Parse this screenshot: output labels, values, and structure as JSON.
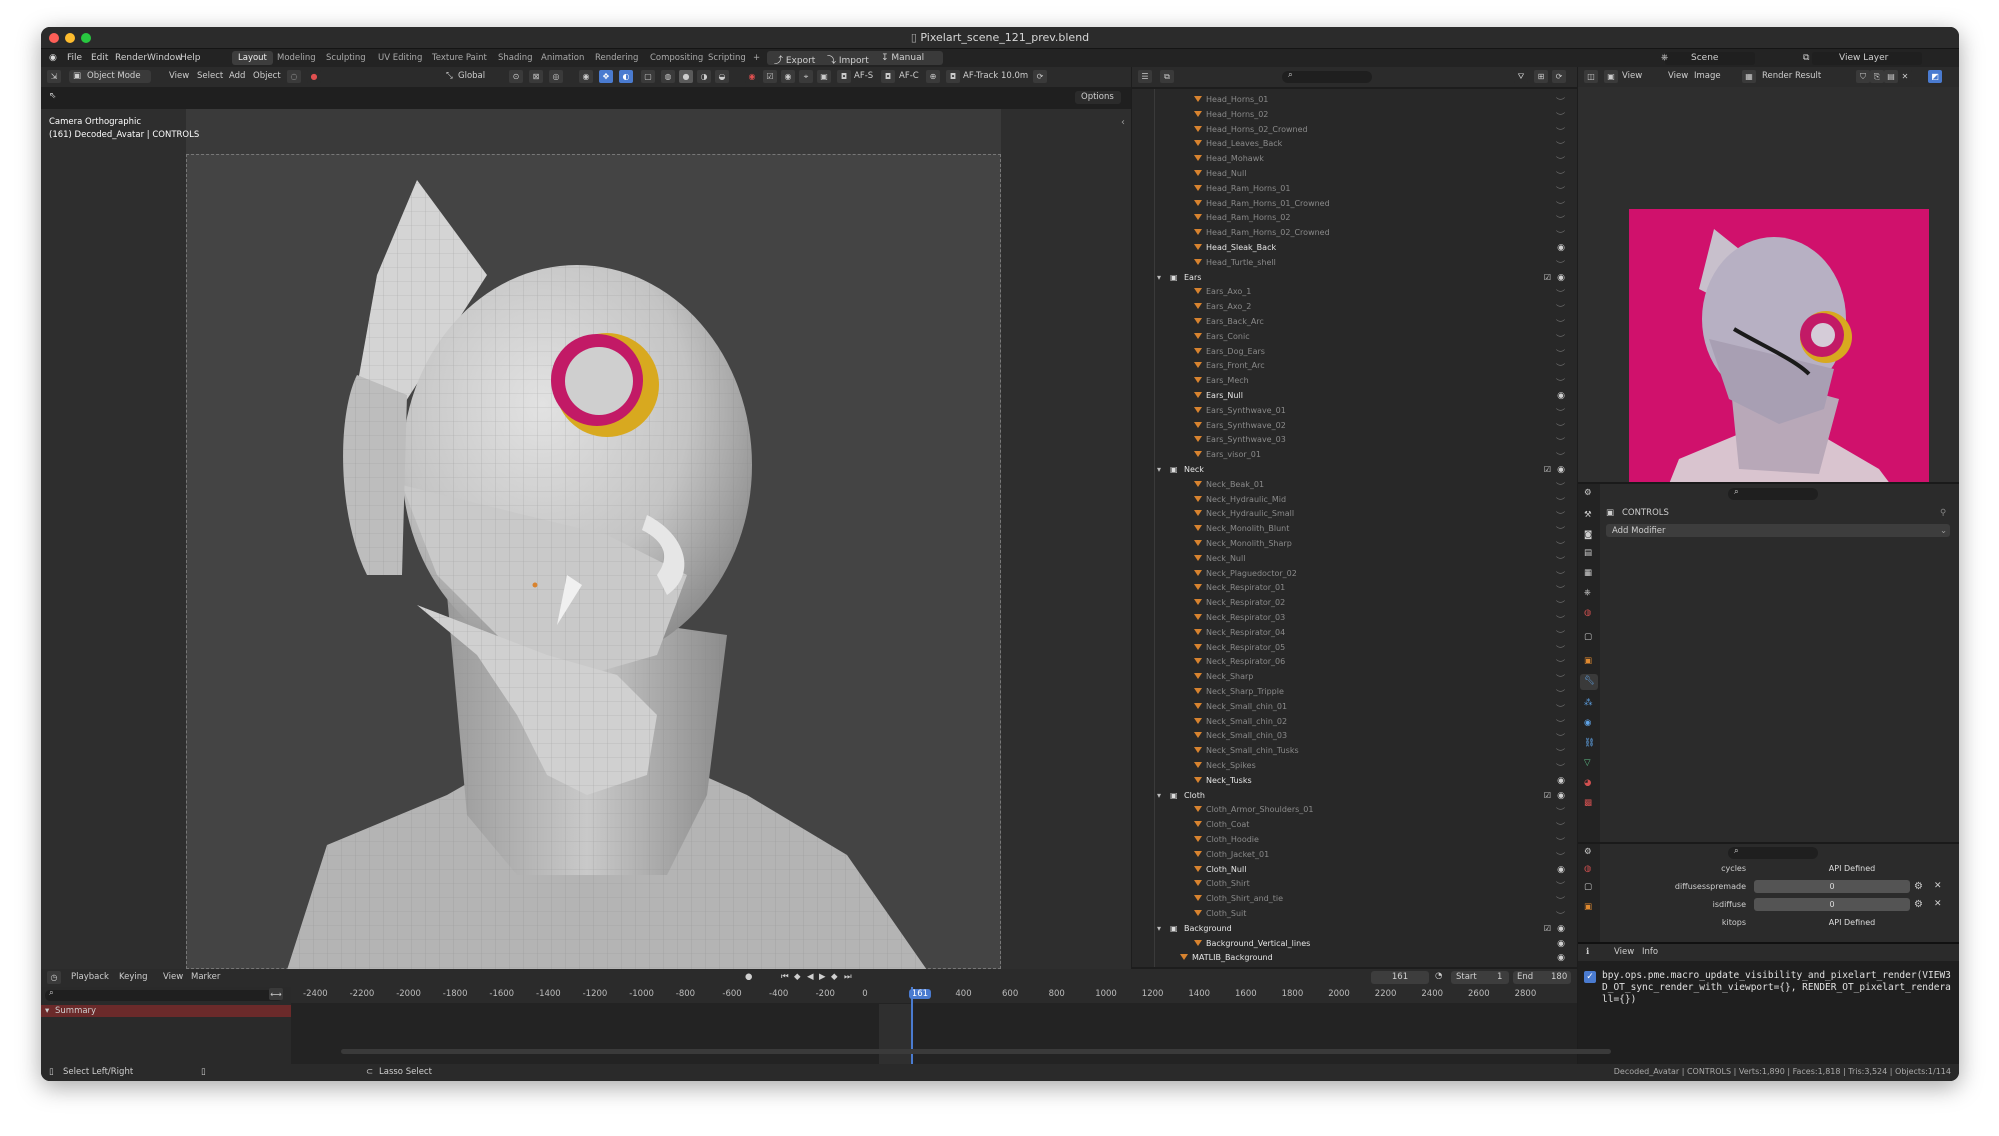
{
  "window": {
    "title": "Pixelart_scene_121_prev.blend"
  },
  "menu": [
    "File",
    "Edit",
    "Render",
    "Window",
    "Help"
  ],
  "workspaces": [
    "Layout",
    "Modeling",
    "Sculpting",
    "UV Editing",
    "Texture Paint",
    "Shading",
    "Animation",
    "Rendering",
    "Compositing",
    "Scripting"
  ],
  "workspace_active": "Layout",
  "topbar": {
    "add_tab": "+",
    "export": "Export",
    "import": "Import",
    "manual": "Manual",
    "scene": "Scene",
    "view_layer": "View Layer"
  },
  "viewport_header": {
    "mode": "Object Mode",
    "view": "View",
    "select": "Select",
    "add": "Add",
    "object": "Object",
    "orientation": "Global",
    "af_s": "AF-S",
    "af_c": "AF-C",
    "af_track": "AF-Track",
    "focus": "10.0m",
    "options": "Options"
  },
  "viewport": {
    "camera_label": "Camera Orthographic",
    "object_label": "(161) Decoded_Avatar | CONTROLS"
  },
  "outliner": {
    "rows": [
      {
        "label": "Head_Horns_01",
        "kind": "item",
        "bright": false
      },
      {
        "label": "Head_Horns_02",
        "kind": "item",
        "bright": false
      },
      {
        "label": "Head_Horns_02_Crowned",
        "kind": "item",
        "bright": false
      },
      {
        "label": "Head_Leaves_Back",
        "kind": "item",
        "bright": false
      },
      {
        "label": "Head_Mohawk",
        "kind": "item",
        "bright": false
      },
      {
        "label": "Head_Null",
        "kind": "item",
        "bright": false
      },
      {
        "label": "Head_Ram_Horns_01",
        "kind": "item",
        "bright": false
      },
      {
        "label": "Head_Ram_Horns_01_Crowned",
        "kind": "item",
        "bright": false
      },
      {
        "label": "Head_Ram_Horns_02",
        "kind": "item",
        "bright": false
      },
      {
        "label": "Head_Ram_Horns_02_Crowned",
        "kind": "item",
        "bright": false
      },
      {
        "label": "Head_Sleak_Back",
        "kind": "item",
        "bright": true
      },
      {
        "label": "Head_Turtle_shell",
        "kind": "item",
        "bright": false
      },
      {
        "label": "Ears",
        "kind": "collection",
        "bright": true
      },
      {
        "label": "Ears_Axo_1",
        "kind": "item",
        "bright": false
      },
      {
        "label": "Ears_Axo_2",
        "kind": "item",
        "bright": false
      },
      {
        "label": "Ears_Back_Arc",
        "kind": "item",
        "bright": false
      },
      {
        "label": "Ears_Conic",
        "kind": "item",
        "bright": false
      },
      {
        "label": "Ears_Dog_Ears",
        "kind": "item",
        "bright": false
      },
      {
        "label": "Ears_Front_Arc",
        "kind": "item",
        "bright": false
      },
      {
        "label": "Ears_Mech",
        "kind": "item",
        "bright": false
      },
      {
        "label": "Ears_Null",
        "kind": "item",
        "bright": true
      },
      {
        "label": "Ears_Synthwave_01",
        "kind": "item",
        "bright": false
      },
      {
        "label": "Ears_Synthwave_02",
        "kind": "item",
        "bright": false
      },
      {
        "label": "Ears_Synthwave_03",
        "kind": "item",
        "bright": false
      },
      {
        "label": "Ears_visor_01",
        "kind": "item",
        "bright": false
      },
      {
        "label": "Neck",
        "kind": "collection",
        "bright": true
      },
      {
        "label": "Neck_Beak_01",
        "kind": "item",
        "bright": false
      },
      {
        "label": "Neck_Hydraulic_Mid",
        "kind": "item",
        "bright": false
      },
      {
        "label": "Neck_Hydraulic_Small",
        "kind": "item",
        "bright": false
      },
      {
        "label": "Neck_Monolith_Blunt",
        "kind": "item",
        "bright": false
      },
      {
        "label": "Neck_Monolith_Sharp",
        "kind": "item",
        "bright": false
      },
      {
        "label": "Neck_Null",
        "kind": "item",
        "bright": false
      },
      {
        "label": "Neck_Plaguedoctor_02",
        "kind": "item",
        "bright": false
      },
      {
        "label": "Neck_Respirator_01",
        "kind": "item",
        "bright": false
      },
      {
        "label": "Neck_Respirator_02",
        "kind": "item",
        "bright": false
      },
      {
        "label": "Neck_Respirator_03",
        "kind": "item",
        "bright": false
      },
      {
        "label": "Neck_Respirator_04",
        "kind": "item",
        "bright": false
      },
      {
        "label": "Neck_Respirator_05",
        "kind": "item",
        "bright": false
      },
      {
        "label": "Neck_Respirator_06",
        "kind": "item",
        "bright": false
      },
      {
        "label": "Neck_Sharp",
        "kind": "item",
        "bright": false
      },
      {
        "label": "Neck_Sharp_Tripple",
        "kind": "item",
        "bright": false
      },
      {
        "label": "Neck_Small_chin_01",
        "kind": "item",
        "bright": false
      },
      {
        "label": "Neck_Small_chin_02",
        "kind": "item",
        "bright": false
      },
      {
        "label": "Neck_Small_chin_03",
        "kind": "item",
        "bright": false
      },
      {
        "label": "Neck_Small_chin_Tusks",
        "kind": "item",
        "bright": false
      },
      {
        "label": "Neck_Spikes",
        "kind": "item",
        "bright": false
      },
      {
        "label": "Neck_Tusks",
        "kind": "item",
        "bright": true
      },
      {
        "label": "Cloth",
        "kind": "collection",
        "bright": true
      },
      {
        "label": "Cloth_Armor_Shoulders_01",
        "kind": "item",
        "bright": false
      },
      {
        "label": "Cloth_Coat",
        "kind": "item",
        "bright": false
      },
      {
        "label": "Cloth_Hoodie",
        "kind": "item",
        "bright": false
      },
      {
        "label": "Cloth_Jacket_01",
        "kind": "item",
        "bright": false
      },
      {
        "label": "Cloth_Null",
        "kind": "item",
        "bright": true
      },
      {
        "label": "Cloth_Shirt",
        "kind": "item",
        "bright": false
      },
      {
        "label": "Cloth_Shirt_and_tie",
        "kind": "item",
        "bright": false
      },
      {
        "label": "Cloth_Suit",
        "kind": "item",
        "bright": false
      },
      {
        "label": "Background",
        "kind": "collection",
        "bright": true
      },
      {
        "label": "Background_Vertical_lines",
        "kind": "item",
        "bright": true
      },
      {
        "label": "MATLIB_Background",
        "kind": "topitem",
        "bright": true
      }
    ]
  },
  "image_editor": {
    "view": "View",
    "view2": "View",
    "image": "Image",
    "render_result": "Render Result"
  },
  "properties": {
    "object_name": "CONTROLS",
    "add_modifier": "Add Modifier"
  },
  "custom_props": [
    {
      "label": "cycles",
      "value": "API Defined",
      "has_controls": false
    },
    {
      "label": "diffusesspremade",
      "value": "0",
      "has_controls": true
    },
    {
      "label": "isdiffuse",
      "value": "0",
      "has_controls": true
    },
    {
      "label": "kitops",
      "value": "API Defined",
      "has_controls": false
    }
  ],
  "info": {
    "view": "View",
    "info": "Info",
    "log": "bpy.ops.pme.macro_update_visibility_and_pixelart_render(VIEW3D_OT_sync_render_with_viewport={}, RENDER_OT_pixelart_renderall={})"
  },
  "timeline": {
    "playback": "Playback",
    "keying": "Keying",
    "view": "View",
    "marker": "Marker",
    "current_frame": "161",
    "start_label": "Start",
    "start": "1",
    "end_label": "End",
    "end": "180",
    "summary": "Summary",
    "ticks": [
      "-2400",
      "-2200",
      "-2000",
      "-1800",
      "-1600",
      "-1400",
      "-1200",
      "-1000",
      "-800",
      "-600",
      "-400",
      "-200",
      "0",
      "161",
      "400",
      "600",
      "800",
      "1000",
      "1200",
      "1400",
      "1600",
      "1800",
      "2000",
      "2200",
      "2400",
      "2600",
      "2800"
    ]
  },
  "status": {
    "select": "Select Left/Right",
    "lasso": "Lasso Select",
    "stats": "Decoded_Avatar | CONTROLS | Verts:1,890 | Faces:1,818 | Tris:3,524 | Objects:1/114"
  },
  "colors": {
    "accent_blue": "#4a7bd0",
    "object_orange": "#d8832f",
    "render_bg": "#d0116c",
    "eye_magenta": "#c21a66",
    "eye_gold": "#d8a91f"
  }
}
